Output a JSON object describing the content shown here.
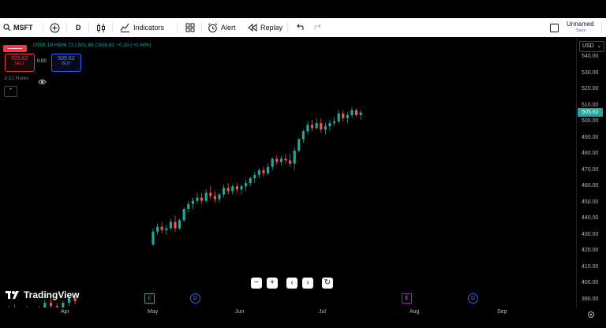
{
  "toolbar": {
    "symbol": "MSFT",
    "interval": "D",
    "indicators_label": "Indicators",
    "alert_label": "Alert",
    "replay_label": "Replay",
    "layout_name": "Unnamed",
    "save_label": "Save"
  },
  "legend": {
    "o_label": "O",
    "o": "505.18",
    "h_label": "H",
    "h": "506.72",
    "l_label": "L",
    "l": "501.89",
    "c_label": "C",
    "c": "505.62",
    "change": "−0.20 (−0.04%)"
  },
  "trade": {
    "sell_price": "505.62",
    "sell_label": "SELL",
    "spread": "0.00",
    "buy_price": "505.62",
    "buy_label": "BUY"
  },
  "rules_label": "3-22 Rules",
  "currency": "USD",
  "last_price": "505.62",
  "price_ticks": [
    "540.00",
    "530.00",
    "520.00",
    "510.00",
    "500.00",
    "490.00",
    "480.00",
    "470.00",
    "460.00",
    "450.00",
    "440.00",
    "430.00",
    "420.00",
    "410.00",
    "400.00",
    "390.00"
  ],
  "time_ticks": [
    "Apr",
    "May",
    "Jun",
    "Jul",
    "Aug",
    "Sep"
  ],
  "events": [
    {
      "type": "E",
      "label": "E",
      "state": "past"
    },
    {
      "type": "D",
      "label": "D",
      "state": "past"
    },
    {
      "type": "E",
      "label": "E",
      "state": "upcoming"
    },
    {
      "type": "D",
      "label": "D",
      "state": "upcoming"
    }
  ],
  "brand": "TradingView",
  "colors": {
    "up": "#26a69a",
    "down": "#ef5350",
    "background": "#000000"
  },
  "chart_data": {
    "type": "candlestick",
    "symbol": "MSFT",
    "interval": "D",
    "ylim": [
      390,
      540
    ],
    "x_labels": [
      "Apr",
      "May",
      "Jun",
      "Jul",
      "Aug",
      "Sep"
    ],
    "candles": [
      {
        "o": 383,
        "h": 386,
        "l": 380,
        "c": 385
      },
      {
        "o": 385,
        "h": 387,
        "l": 381,
        "c": 382
      },
      {
        "o": 382,
        "h": 385,
        "l": 378,
        "c": 384
      },
      {
        "o": 384,
        "h": 386,
        "l": 379,
        "c": 380
      },
      {
        "o": 380,
        "h": 384,
        "l": 377,
        "c": 383
      },
      {
        "o": 383,
        "h": 386,
        "l": 381,
        "c": 385
      },
      {
        "o": 385,
        "h": 390,
        "l": 383,
        "c": 388
      },
      {
        "o": 388,
        "h": 391,
        "l": 384,
        "c": 386
      },
      {
        "o": 386,
        "h": 388,
        "l": 381,
        "c": 384
      },
      {
        "o": 384,
        "h": 389,
        "l": 383,
        "c": 388
      },
      {
        "o": 388,
        "h": 392,
        "l": 386,
        "c": 391
      },
      {
        "o": 391,
        "h": 393,
        "l": 387,
        "c": 389
      },
      {
        "o": 424,
        "h": 434,
        "l": 423,
        "c": 432
      },
      {
        "o": 432,
        "h": 437,
        "l": 430,
        "c": 435
      },
      {
        "o": 435,
        "h": 438,
        "l": 431,
        "c": 433
      },
      {
        "o": 433,
        "h": 436,
        "l": 430,
        "c": 434
      },
      {
        "o": 434,
        "h": 440,
        "l": 433,
        "c": 438
      },
      {
        "o": 438,
        "h": 442,
        "l": 432,
        "c": 434
      },
      {
        "o": 434,
        "h": 440,
        "l": 433,
        "c": 439
      },
      {
        "o": 439,
        "h": 447,
        "l": 438,
        "c": 446
      },
      {
        "o": 446,
        "h": 451,
        "l": 444,
        "c": 449
      },
      {
        "o": 449,
        "h": 453,
        "l": 446,
        "c": 451
      },
      {
        "o": 451,
        "h": 456,
        "l": 449,
        "c": 453
      },
      {
        "o": 453,
        "h": 456,
        "l": 449,
        "c": 451
      },
      {
        "o": 451,
        "h": 458,
        "l": 450,
        "c": 456
      },
      {
        "o": 456,
        "h": 460,
        "l": 452,
        "c": 454
      },
      {
        "o": 454,
        "h": 457,
        "l": 450,
        "c": 452
      },
      {
        "o": 452,
        "h": 456,
        "l": 450,
        "c": 455
      },
      {
        "o": 455,
        "h": 461,
        "l": 453,
        "c": 459
      },
      {
        "o": 459,
        "h": 462,
        "l": 455,
        "c": 457
      },
      {
        "o": 457,
        "h": 461,
        "l": 455,
        "c": 460
      },
      {
        "o": 460,
        "h": 462,
        "l": 456,
        "c": 458
      },
      {
        "o": 458,
        "h": 461,
        "l": 455,
        "c": 460
      },
      {
        "o": 460,
        "h": 464,
        "l": 457,
        "c": 462
      },
      {
        "o": 462,
        "h": 466,
        "l": 460,
        "c": 465
      },
      {
        "o": 465,
        "h": 469,
        "l": 462,
        "c": 467
      },
      {
        "o": 467,
        "h": 471,
        "l": 465,
        "c": 470
      },
      {
        "o": 470,
        "h": 472,
        "l": 466,
        "c": 468
      },
      {
        "o": 468,
        "h": 474,
        "l": 467,
        "c": 472
      },
      {
        "o": 472,
        "h": 478,
        "l": 470,
        "c": 477
      },
      {
        "o": 477,
        "h": 479,
        "l": 473,
        "c": 475
      },
      {
        "o": 475,
        "h": 479,
        "l": 473,
        "c": 477
      },
      {
        "o": 477,
        "h": 480,
        "l": 474,
        "c": 476
      },
      {
        "o": 476,
        "h": 480,
        "l": 472,
        "c": 474
      },
      {
        "o": 474,
        "h": 484,
        "l": 470,
        "c": 482
      },
      {
        "o": 482,
        "h": 490,
        "l": 481,
        "c": 489
      },
      {
        "o": 489,
        "h": 495,
        "l": 487,
        "c": 494
      },
      {
        "o": 494,
        "h": 500,
        "l": 492,
        "c": 498
      },
      {
        "o": 498,
        "h": 501,
        "l": 494,
        "c": 496
      },
      {
        "o": 496,
        "h": 502,
        "l": 495,
        "c": 499
      },
      {
        "o": 499,
        "h": 502,
        "l": 493,
        "c": 495
      },
      {
        "o": 495,
        "h": 499,
        "l": 492,
        "c": 497
      },
      {
        "o": 497,
        "h": 501,
        "l": 494,
        "c": 499
      },
      {
        "o": 499,
        "h": 503,
        "l": 497,
        "c": 500
      },
      {
        "o": 500,
        "h": 507,
        "l": 499,
        "c": 505
      },
      {
        "o": 505,
        "h": 507,
        "l": 500,
        "c": 502
      },
      {
        "o": 502,
        "h": 506,
        "l": 499,
        "c": 504
      },
      {
        "o": 504,
        "h": 509,
        "l": 502,
        "c": 507
      },
      {
        "o": 507,
        "h": 508,
        "l": 503,
        "c": 504
      },
      {
        "o": 504,
        "h": 507,
        "l": 501,
        "c": 505.62
      }
    ]
  }
}
